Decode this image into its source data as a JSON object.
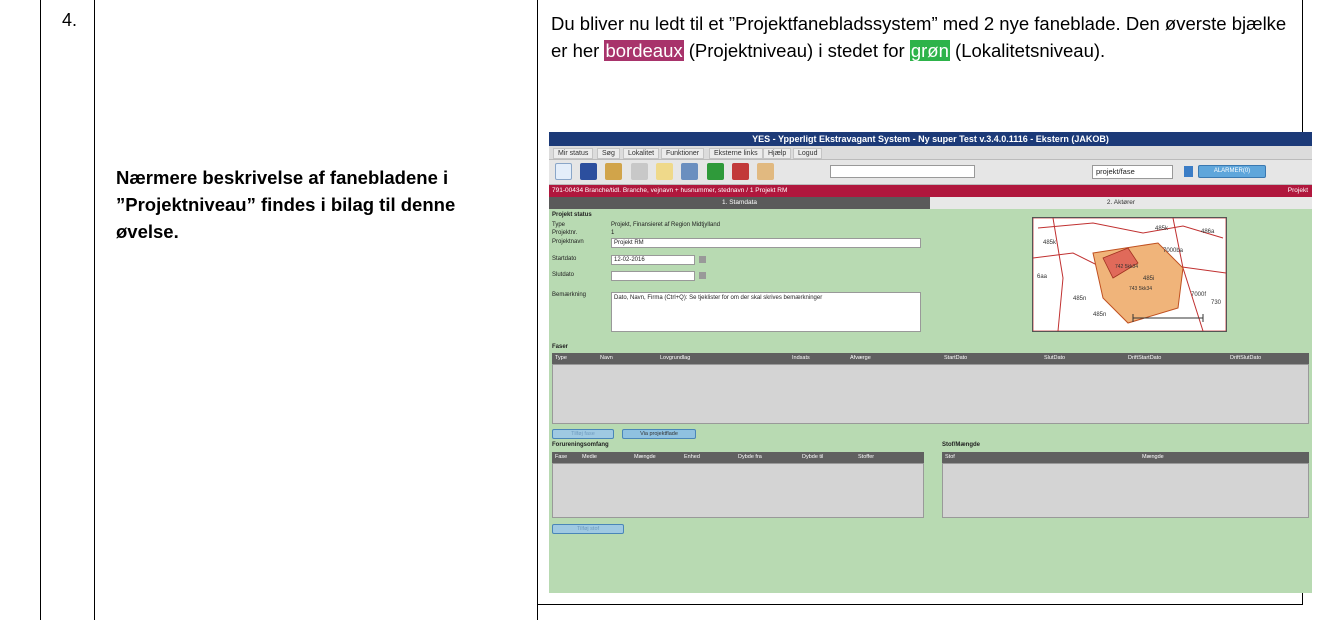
{
  "step_number": "4.",
  "description": "Nærmere beskrivelse af fanebladene i ”Projektniveau” findes i bilag til denne øvelse.",
  "instruction": {
    "part1": "Du bliver nu ledt til et ”Projektfanebladssystem” med 2 nye faneblade. Den øverste bjælke er her ",
    "bordeaux": "bordeaux",
    "part2": " (Projektniveau) i stedet for ",
    "green": "grøn",
    "part3": " (Lokalitetsniveau)."
  },
  "colors": {
    "bordeaux": "#a8336b",
    "green": "#2db34a",
    "app_title_bar": "#1c3a78",
    "project_bar": "#b0173d",
    "form_bg": "#b8dab2"
  },
  "screenshot": {
    "title": "YES - Ypperligt Ekstravagant System - Ny super Test v.3.4.0.1116 - Ekstern (JAKOB)",
    "menu": [
      "Mir status",
      "Søg",
      "Lokalitet",
      "Funktioner",
      "Eksterne links",
      "Hjælp",
      "Logud"
    ],
    "toolbar_icons": [
      "new-icon",
      "save-icon",
      "folder-icon",
      "print-icon",
      "note-icon",
      "document-icon",
      "filter-icon",
      "pdf-icon",
      "report-icon"
    ],
    "project_search": "projekt/fase",
    "blue_button": "ALARMER(0)",
    "project_bar": "791-00434 Branche/tidl. Branche, vejnavn + husnummer, stednavn / 1 Projekt RM",
    "project_bar_right": "Projekt",
    "tabs": [
      "1. Stamdata",
      "2. Aktører"
    ],
    "section_status": "Projekt status",
    "fields": {
      "type_label": "Type",
      "type_value": "Projekt, Finansieret af Region Midtjylland",
      "projektnr_label": "Projektnr.",
      "projektnr_value": "1",
      "projektnavn_label": "Projektnavn",
      "projektnavn_value": "Projekt RM",
      "startdato_label": "Startdato",
      "startdato_value": "12-02-2016",
      "slutdato_label": "Slutdato",
      "bemaerkning_label": "Bemærkning",
      "bemaerkning_value": "Dato, Navn, Firma (Ctrl+Q): Se tjeklister for om der skal skrives bemærkninger"
    },
    "map_labels": [
      "485k",
      "486a",
      "485k",
      "7000ba",
      "6aa",
      "742 5kk34",
      "485i",
      "743 5kk34",
      "7000f",
      "730",
      "485n",
      "485n"
    ],
    "faser_title": "Faser",
    "faser_columns": [
      "Type",
      "Navn",
      "Lovgrundlag",
      "Indsats",
      "Afværge",
      "StartDato",
      "SlutDato",
      "DriftStartDato",
      "DriftSlutDato"
    ],
    "btn_tilfoej_fase": "Tilføj fase",
    "btn_via_projektflade": "Via projektflade",
    "forurening_title": "Forureningsomfang",
    "forurening_columns": [
      "Fase",
      "Medie",
      "Mængde",
      "Enhed",
      "Dybde fra",
      "Dybde til",
      "Stoffer"
    ],
    "stof_title": "Stof/Mængde",
    "stof_columns": [
      "Stof",
      "Mængde"
    ],
    "btn_tilfoej_bottom": "Tilføj stof"
  }
}
